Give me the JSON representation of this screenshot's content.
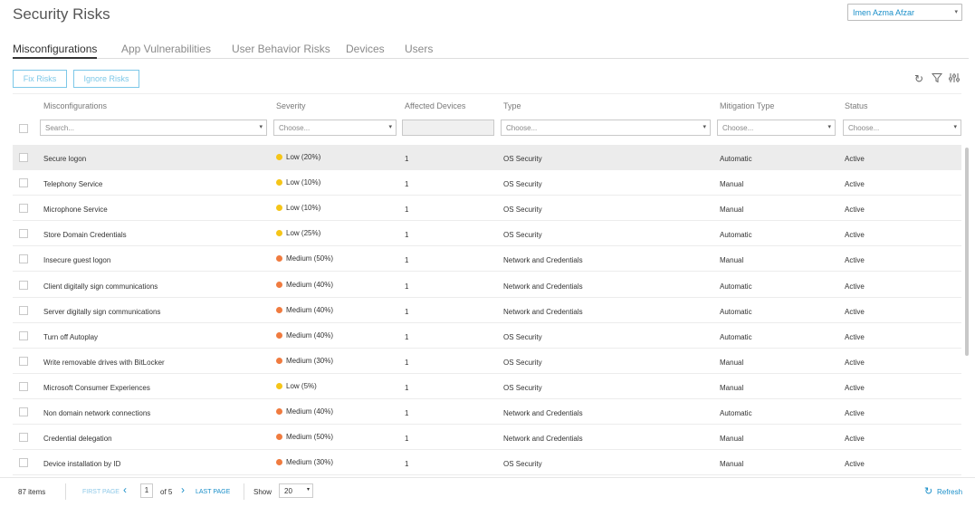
{
  "header": {
    "title": "Security Risks",
    "user": "Imen Azma Afzar"
  },
  "tabs": [
    "Misconfigurations",
    "App Vulnerabilities",
    "User Behavior Risks",
    "Devices",
    "Users"
  ],
  "actions": {
    "fix": "Fix Risks",
    "ignore": "Ignore Risks"
  },
  "columns": [
    "Misconfigurations",
    "Severity",
    "Affected Devices",
    "Type",
    "Mitigation Type",
    "Status"
  ],
  "filters": {
    "search_placeholder": "Search...",
    "choose": "Choose..."
  },
  "colors": {
    "low": "#f5c518",
    "medium": "#f07b3f",
    "accent": "#1a8fc9"
  },
  "rows": [
    {
      "name": "Secure logon",
      "severity": "Low (20%)",
      "level": "low",
      "devices": "1",
      "type": "OS Security",
      "mitigation": "Automatic",
      "status": "Active"
    },
    {
      "name": "Telephony Service",
      "severity": "Low (10%)",
      "level": "low",
      "devices": "1",
      "type": "OS Security",
      "mitigation": "Manual",
      "status": "Active"
    },
    {
      "name": "Microphone Service",
      "severity": "Low (10%)",
      "level": "low",
      "devices": "1",
      "type": "OS Security",
      "mitigation": "Manual",
      "status": "Active"
    },
    {
      "name": "Store Domain Credentials",
      "severity": "Low (25%)",
      "level": "low",
      "devices": "1",
      "type": "OS Security",
      "mitigation": "Automatic",
      "status": "Active"
    },
    {
      "name": "Insecure guest logon",
      "severity": "Medium (50%)",
      "level": "medium",
      "devices": "1",
      "type": "Network and Credentials",
      "mitigation": "Manual",
      "status": "Active"
    },
    {
      "name": "Client digitally sign communications",
      "severity": "Medium (40%)",
      "level": "medium",
      "devices": "1",
      "type": "Network and Credentials",
      "mitigation": "Automatic",
      "status": "Active"
    },
    {
      "name": "Server digitally sign communications",
      "severity": "Medium (40%)",
      "level": "medium",
      "devices": "1",
      "type": "Network and Credentials",
      "mitigation": "Automatic",
      "status": "Active"
    },
    {
      "name": "Turn off Autoplay",
      "severity": "Medium (40%)",
      "level": "medium",
      "devices": "1",
      "type": "OS Security",
      "mitigation": "Automatic",
      "status": "Active"
    },
    {
      "name": "Write removable drives with BitLocker",
      "severity": "Medium (30%)",
      "level": "medium",
      "devices": "1",
      "type": "OS Security",
      "mitigation": "Manual",
      "status": "Active"
    },
    {
      "name": "Microsoft Consumer Experiences",
      "severity": "Low (5%)",
      "level": "low",
      "devices": "1",
      "type": "OS Security",
      "mitigation": "Manual",
      "status": "Active"
    },
    {
      "name": "Non domain network connections",
      "severity": "Medium (40%)",
      "level": "medium",
      "devices": "1",
      "type": "Network and Credentials",
      "mitigation": "Automatic",
      "status": "Active"
    },
    {
      "name": "Credential delegation",
      "severity": "Medium (50%)",
      "level": "medium",
      "devices": "1",
      "type": "Network and Credentials",
      "mitigation": "Manual",
      "status": "Active"
    },
    {
      "name": "Device installation by ID",
      "severity": "Medium (30%)",
      "level": "medium",
      "devices": "1",
      "type": "OS Security",
      "mitigation": "Manual",
      "status": "Active"
    }
  ],
  "footer": {
    "items": "87 items",
    "first_page": "FIRST PAGE",
    "page": "1",
    "of": "of 5",
    "last_page": "LAST PAGE",
    "show": "Show",
    "page_size": "20",
    "refresh": "Refresh"
  }
}
